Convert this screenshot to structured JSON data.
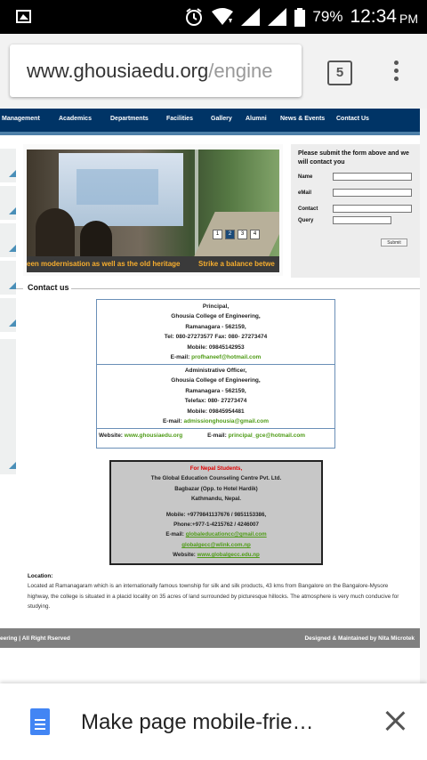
{
  "status_bar": {
    "battery": "79%",
    "time": "12:34",
    "ampm": "PM"
  },
  "browser": {
    "url_main": "www.ghousiaedu.org",
    "url_path": "/engine",
    "tab_count": "5"
  },
  "nav": {
    "items": [
      "Management",
      "Academics",
      "Departments",
      "Facilities",
      "Gallery",
      "Alumni",
      "News & Events",
      "Contact Us"
    ]
  },
  "slider": {
    "caption_left": "een modernisation as well as the old heritage",
    "caption_right": "Strike a balance betwe",
    "pages": [
      "1",
      "2",
      "3",
      "4"
    ],
    "active_page": "2"
  },
  "form": {
    "title": "Please submit the form above and we will contact you",
    "name_label": "Name",
    "email_label": "eMail",
    "contact_label": "Contact",
    "query_label": "Query",
    "submit_label": "Submit"
  },
  "contact": {
    "title": "Contact us",
    "principal": {
      "role": "Principal,",
      "college": "Ghousia College of Engineering,",
      "city": "Ramanagara - 562159,",
      "tel": "Tel: 080-27273577  Fax: 080- 27273474",
      "mobile": "Mobile: 09845142953",
      "email_label": "E-mail:",
      "email": "profhaneef@hotmail.com"
    },
    "admin": {
      "role": "Administrative Officer,",
      "college": "Ghousia College of Engineering,",
      "city": "Ramanagara - 562159,",
      "tel": "Telefax: 080- 27273474",
      "mobile": "Mobile: 09845954481",
      "email_label": "E-mail:",
      "email": "admissionghousia@gmail.com"
    },
    "website_label": "Website:",
    "website": "www.ghousiaedu.org",
    "website_email_label": "E-mail:",
    "website_email": "principal_gce@hotmail.com"
  },
  "nepal": {
    "heading": "For Nepal Students,",
    "org": "The Global Education Counseling Centre Pvt. Ltd.",
    "addr1": "Bagbazar (Opp. to Hotel Hardik)",
    "addr2": "Kathmandu, Nepal.",
    "mobile": "Mobile: +9779841137676 / 9851153386,",
    "phone": "Phone:+977-1-4215762 / 4246007",
    "email_label": "E-mail:",
    "email1": "globaleducationcc@gmail.com",
    "email2": "globalgecc@wlink.com.np",
    "website_label": "Website:",
    "website": "www.globalgecc.edu.np"
  },
  "location": {
    "label": "Location:",
    "text": "Located at Ramanagaram which is an internationally famous township for silk and silk products, 43 kms from Bangalore on the Bangalore-Mysore highway, the college is situated in a placid locality on 35 acres of land surrounded by picturesque hillocks. The atmosphere is very much conducive for studying."
  },
  "footer": {
    "left": "eering | All Right Rserved",
    "right": "Designed & Maintained by Nita Microtek"
  },
  "bottom_bar": {
    "text": "Make page mobile-frie…"
  }
}
